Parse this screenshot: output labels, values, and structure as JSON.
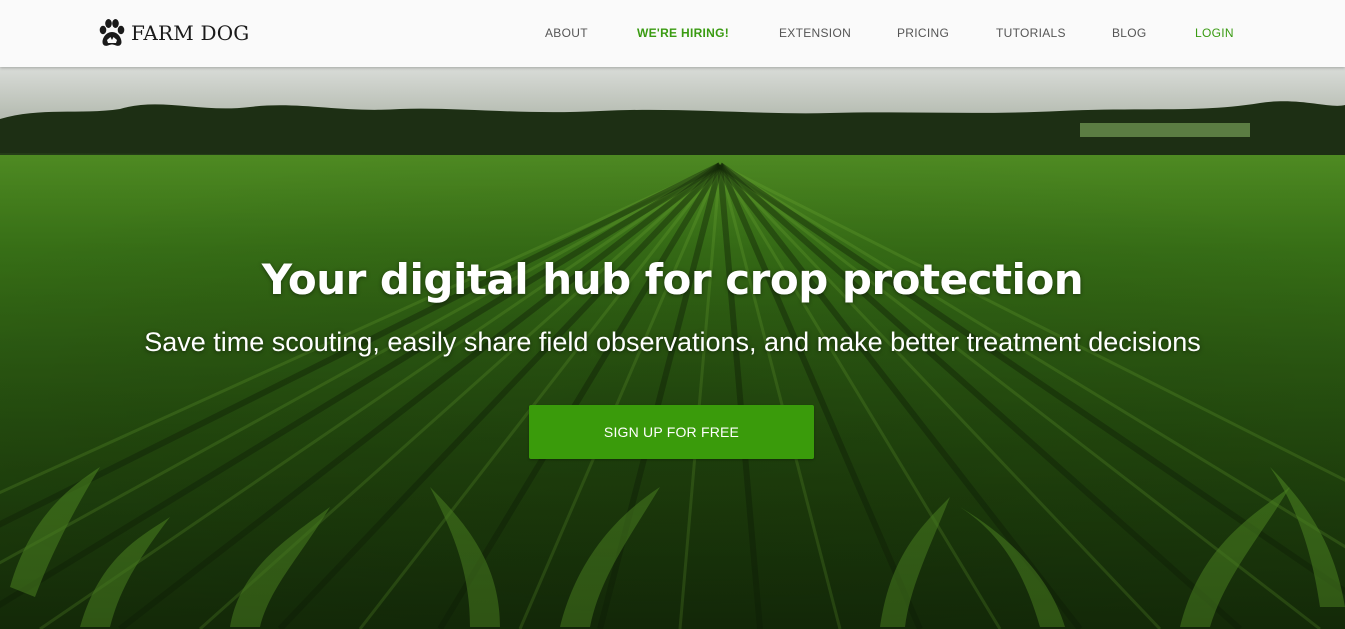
{
  "brand": {
    "name": "FARM DOG",
    "logo_icon": "paw-icon"
  },
  "nav": {
    "items": [
      {
        "label": "ABOUT"
      },
      {
        "label": "WE'RE HIRING!"
      },
      {
        "label": "EXTENSION"
      },
      {
        "label": "PRICING"
      },
      {
        "label": "TUTORIALS"
      },
      {
        "label": "BLOG"
      },
      {
        "label": "LOGIN"
      }
    ]
  },
  "hero": {
    "title": "Your digital hub for crop protection",
    "subtitle": "Save time scouting, easily share field observations, and make better treatment decisions",
    "cta_label": "SIGN UP FOR FREE"
  },
  "colors": {
    "accent_green": "#3a9b0b",
    "nav_text": "#555555",
    "navbar_bg": "#fafafa"
  }
}
